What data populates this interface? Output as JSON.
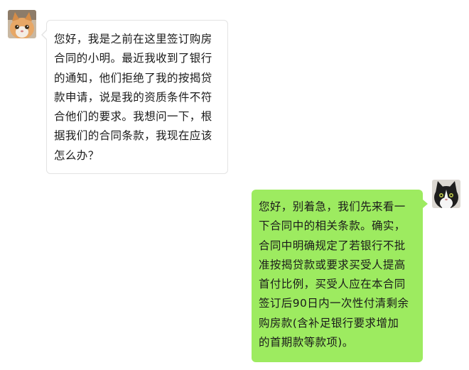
{
  "colors": {
    "incoming_bubble": "#ffffff",
    "incoming_border": "#e3e3e3",
    "outgoing_bubble": "#9deb60",
    "background": "#ffffff"
  },
  "messages": [
    {
      "sender": "user",
      "avatar_icon": "orange-cat-avatar-icon",
      "text": "您好，我是之前在这里签订购房\n合同的小明。最近我收到了银行\n的通知，他们拒绝了我的按揭贷\n款申请，说是我的资质条件不符\n合他们的要求。我想问一下，根\n据我们的合同条款，我现在应该\n怎么办？"
    },
    {
      "sender": "self",
      "avatar_icon": "black-white-cat-avatar-icon",
      "text": "您好，别着急，我们先来看一\n下合同中的相关条款。确实，\n合同中明确规定了若银行不批\n准按揭贷款或要求买受人提高\n首付比例，买受人应在本合同\n签订后90日内一次性付清剩余\n购房款(含补足银行要求增加\n的首期款等款项)。"
    }
  ]
}
